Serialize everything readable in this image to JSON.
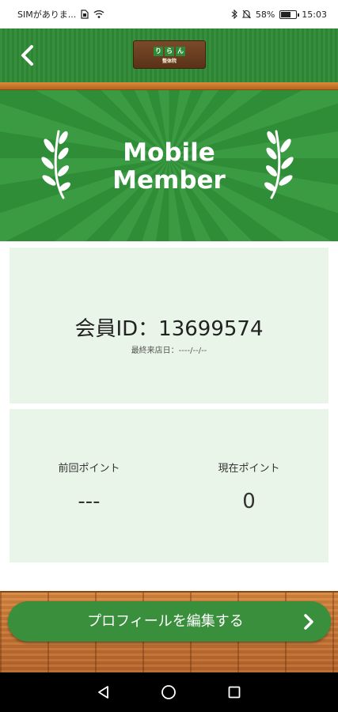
{
  "status_bar": {
    "carrier": "SIMがありま...",
    "battery": "58%",
    "battery_level": 0.58,
    "time": "15:03",
    "icons": [
      "sim-icon",
      "wifi-icon",
      "bluetooth-icon",
      "mute-icon",
      "battery-icon"
    ]
  },
  "header": {
    "back_icon": "chevron-left-icon",
    "logo": {
      "top_text": "",
      "main_text": [
        "り",
        "ら",
        "ん"
      ],
      "sub_text": "整体院"
    }
  },
  "banner": {
    "title_line1": "Mobile",
    "title_line2": "Member",
    "icons": [
      "laurel-left-icon",
      "laurel-right-icon"
    ]
  },
  "member": {
    "id_text": "会員ID：13699574",
    "last_visit": "最終来店日：----/--/--"
  },
  "points": {
    "previous_label": "前回ポイント",
    "previous_value": "---",
    "current_label": "現在ポイント",
    "current_value": "0"
  },
  "actions": {
    "edit_profile_label": "プロフィールを編集する",
    "edit_profile_icon": "chevron-right-icon"
  },
  "nav_bar": {
    "icons": [
      "back-triangle-icon",
      "home-circle-icon",
      "recents-square-icon"
    ]
  },
  "colors": {
    "header_green": "#2f8a36",
    "card_bg": "#e8f5e8",
    "button_green": "#3a8f3c",
    "wood": "#c4743a"
  }
}
